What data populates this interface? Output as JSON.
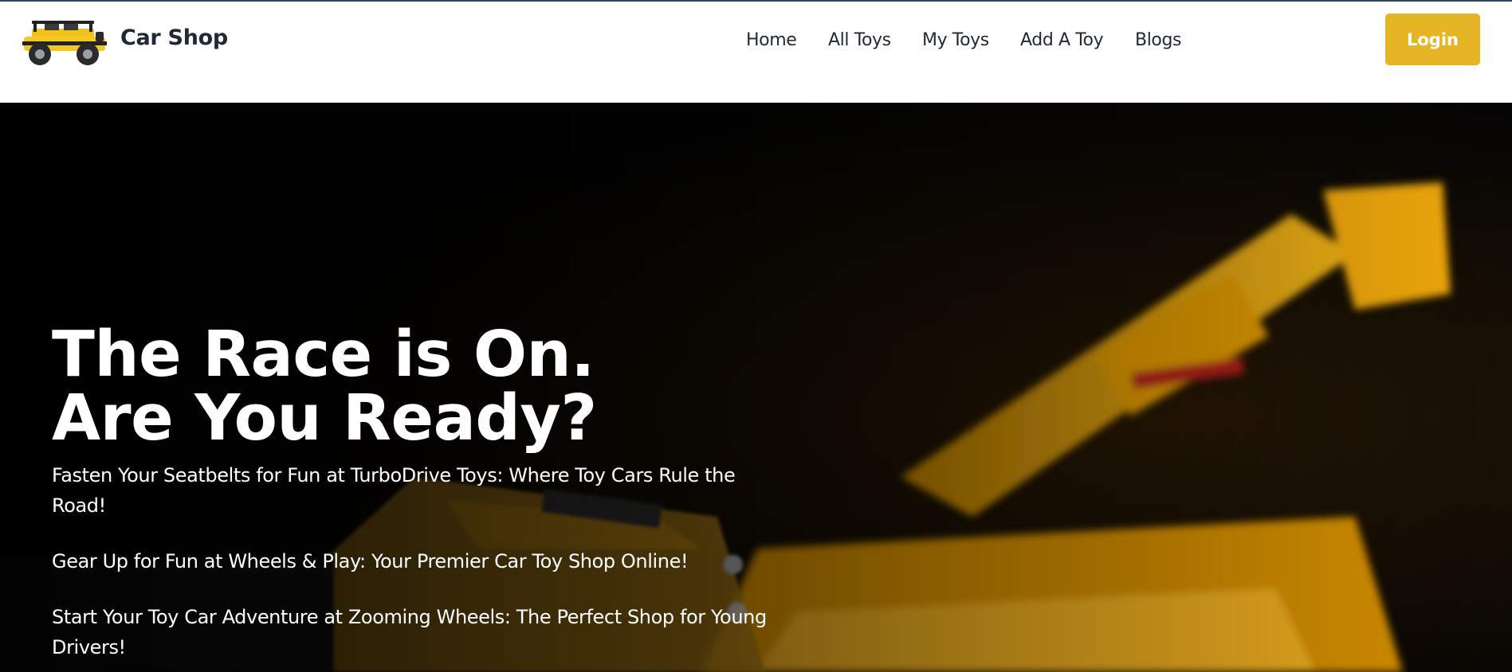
{
  "header": {
    "brand": "Car Shop",
    "logo_icon": "yellow-jeep-icon",
    "nav": [
      {
        "label": "Home"
      },
      {
        "label": "All Toys"
      },
      {
        "label": "My Toys"
      },
      {
        "label": "Add A Toy"
      },
      {
        "label": "Blogs"
      }
    ],
    "login_label": "Login"
  },
  "hero": {
    "title_line1": "The Race is On.",
    "title_line2": "Are You Ready?",
    "paragraphs": [
      "Fasten Your Seatbelts for Fun at TurboDrive Toys: Where Toy Cars Rule the Road!",
      "Gear Up for Fun at Wheels & Play: Your Premier Car Toy Shop Online!",
      "Start Your Toy Car Adventure at Zooming Wheels: The Perfect Shop for Young Drivers!"
    ]
  },
  "colors": {
    "accent": "#e6b525",
    "text_dark": "#1f2937",
    "hero_bg": "#0a0a0a"
  }
}
